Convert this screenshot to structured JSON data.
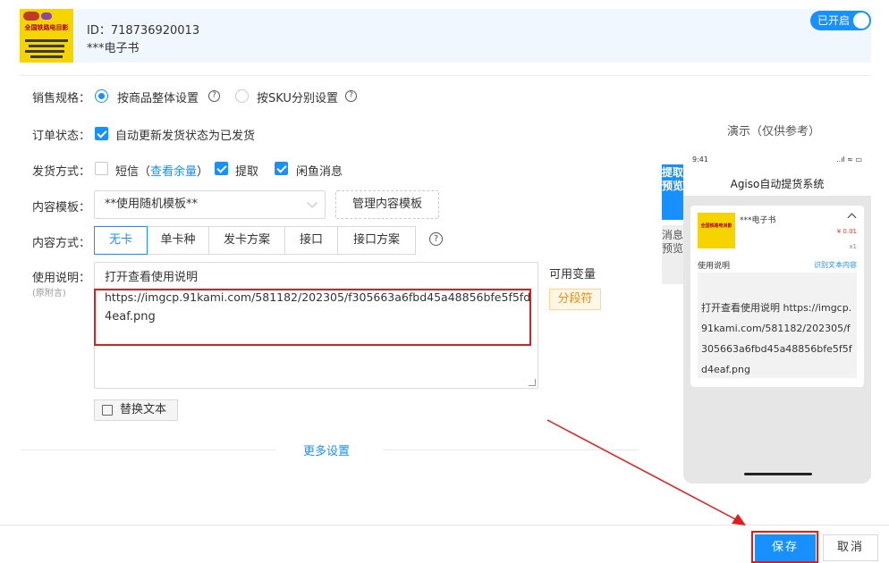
{
  "product": {
    "id_label": "ID：718736920013",
    "name": "***电子书",
    "thumb_title": "全国铁路电目影",
    "toggle_label": "已开启"
  },
  "form": {
    "sale_spec": {
      "label": "销售规格：",
      "option1": "按商品整体设置",
      "option2": "按SKU分别设置",
      "selected": "option1"
    },
    "order_status": {
      "label": "订单状态：",
      "checkbox_label": "自动更新发货状态为已发货",
      "checked": true
    },
    "delivery": {
      "label": "发货方式：",
      "sms_label": "短信",
      "sms_paren_open": "（",
      "sms_link": "查看余量",
      "sms_paren_close": "）",
      "sms_checked": false,
      "pickup_label": "提取",
      "pickup_checked": true,
      "xianyu_label": "闲鱼消息",
      "xianyu_checked": true
    },
    "template": {
      "label": "内容模板：",
      "selected": "**使用随机模板**",
      "manage_button": "管理内容模板"
    },
    "content_mode": {
      "label": "内容方式：",
      "options": [
        "无卡",
        "单卡种",
        "发卡方案",
        "接口",
        "接口方案"
      ],
      "selected": "无卡"
    },
    "instructions": {
      "label": "使用说明：",
      "sublabel": "(原附言)",
      "line1": "打开查看使用说明",
      "line2": "https://imgcp.91kami.com/581182/202305/f305663a6fbd45a48856bfe5f5fd",
      "line3": "4eaf.png",
      "var_title": "可用变量",
      "var_tag": "分段符",
      "replace_button": "替换文本"
    },
    "more_settings": "更多设置"
  },
  "demo": {
    "title": "演示（仅供参考）",
    "tab_active": "提取预览",
    "tab_inactive": "消息预览",
    "phone_time": "9:41",
    "phone_signal": "..ıl ≈ ▭",
    "phone_title": "Agiso自动提货系统",
    "card_name": "***电子书",
    "card_price": "¥ 0.01",
    "card_qty": "x1",
    "usage_label": "使用说明",
    "usage_link": "识别文本内容",
    "usage_text": "打开查看使用说明 https://imgcp.91kami.com/581182/202305/f305663a6fbd45a48856bfe5f5fd4eaf.png"
  },
  "footer": {
    "save_label": "保存",
    "cancel_label": "取消"
  },
  "colors": {
    "accent": "#1890ff",
    "highlight_red": "#e31c1c",
    "tag_orange": "#fa8c16"
  }
}
